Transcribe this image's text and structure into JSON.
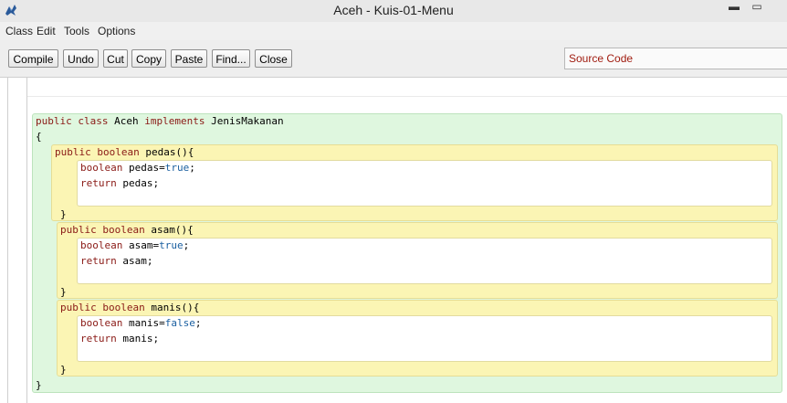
{
  "window": {
    "title": "Aceh - Kuis-01-Menu",
    "min_glyph": "▬",
    "max_glyph": "▭"
  },
  "menu": {
    "items": [
      "Class",
      "Edit",
      "Tools",
      "Options"
    ]
  },
  "toolbar": {
    "buttons": [
      "Compile",
      "Undo",
      "Cut",
      "Copy",
      "Paste",
      "Find...",
      "Close"
    ],
    "view_select": "Source Code"
  },
  "code": {
    "class_decl": {
      "kw1": "public",
      "kw2": "class",
      "name": " Aceh ",
      "kw3": "implements",
      "iface": " JenisMakanan"
    },
    "open_brace": "{",
    "close_brace": "}",
    "methods": [
      {
        "mod": "public",
        "type": "boolean",
        "name": " pedas(){",
        "var_kw": "boolean",
        "var_name": " pedas=",
        "var_val": "true",
        "semi": ";",
        "ret_kw": "return",
        "ret_name": " pedas;",
        "close": "}"
      },
      {
        "mod": "public",
        "type": "boolean",
        "name": " asam(){",
        "var_kw": "boolean",
        "var_name": " asam=",
        "var_val": "true",
        "semi": ";",
        "ret_kw": "return",
        "ret_name": " asam;",
        "close": "}"
      },
      {
        "mod": "public",
        "type": "boolean",
        "name": " manis(){",
        "var_kw": "boolean",
        "var_name": " manis=",
        "var_val": "false",
        "semi": ";",
        "ret_kw": "return",
        "ret_name": " manis;",
        "close": "}"
      }
    ]
  },
  "colors": {
    "keyword": "#8a1a16",
    "literal": "#1a5fa0",
    "class_bg": "#dff7df",
    "method_bg": "#fbf5b4",
    "select_text": "#a01c10"
  }
}
